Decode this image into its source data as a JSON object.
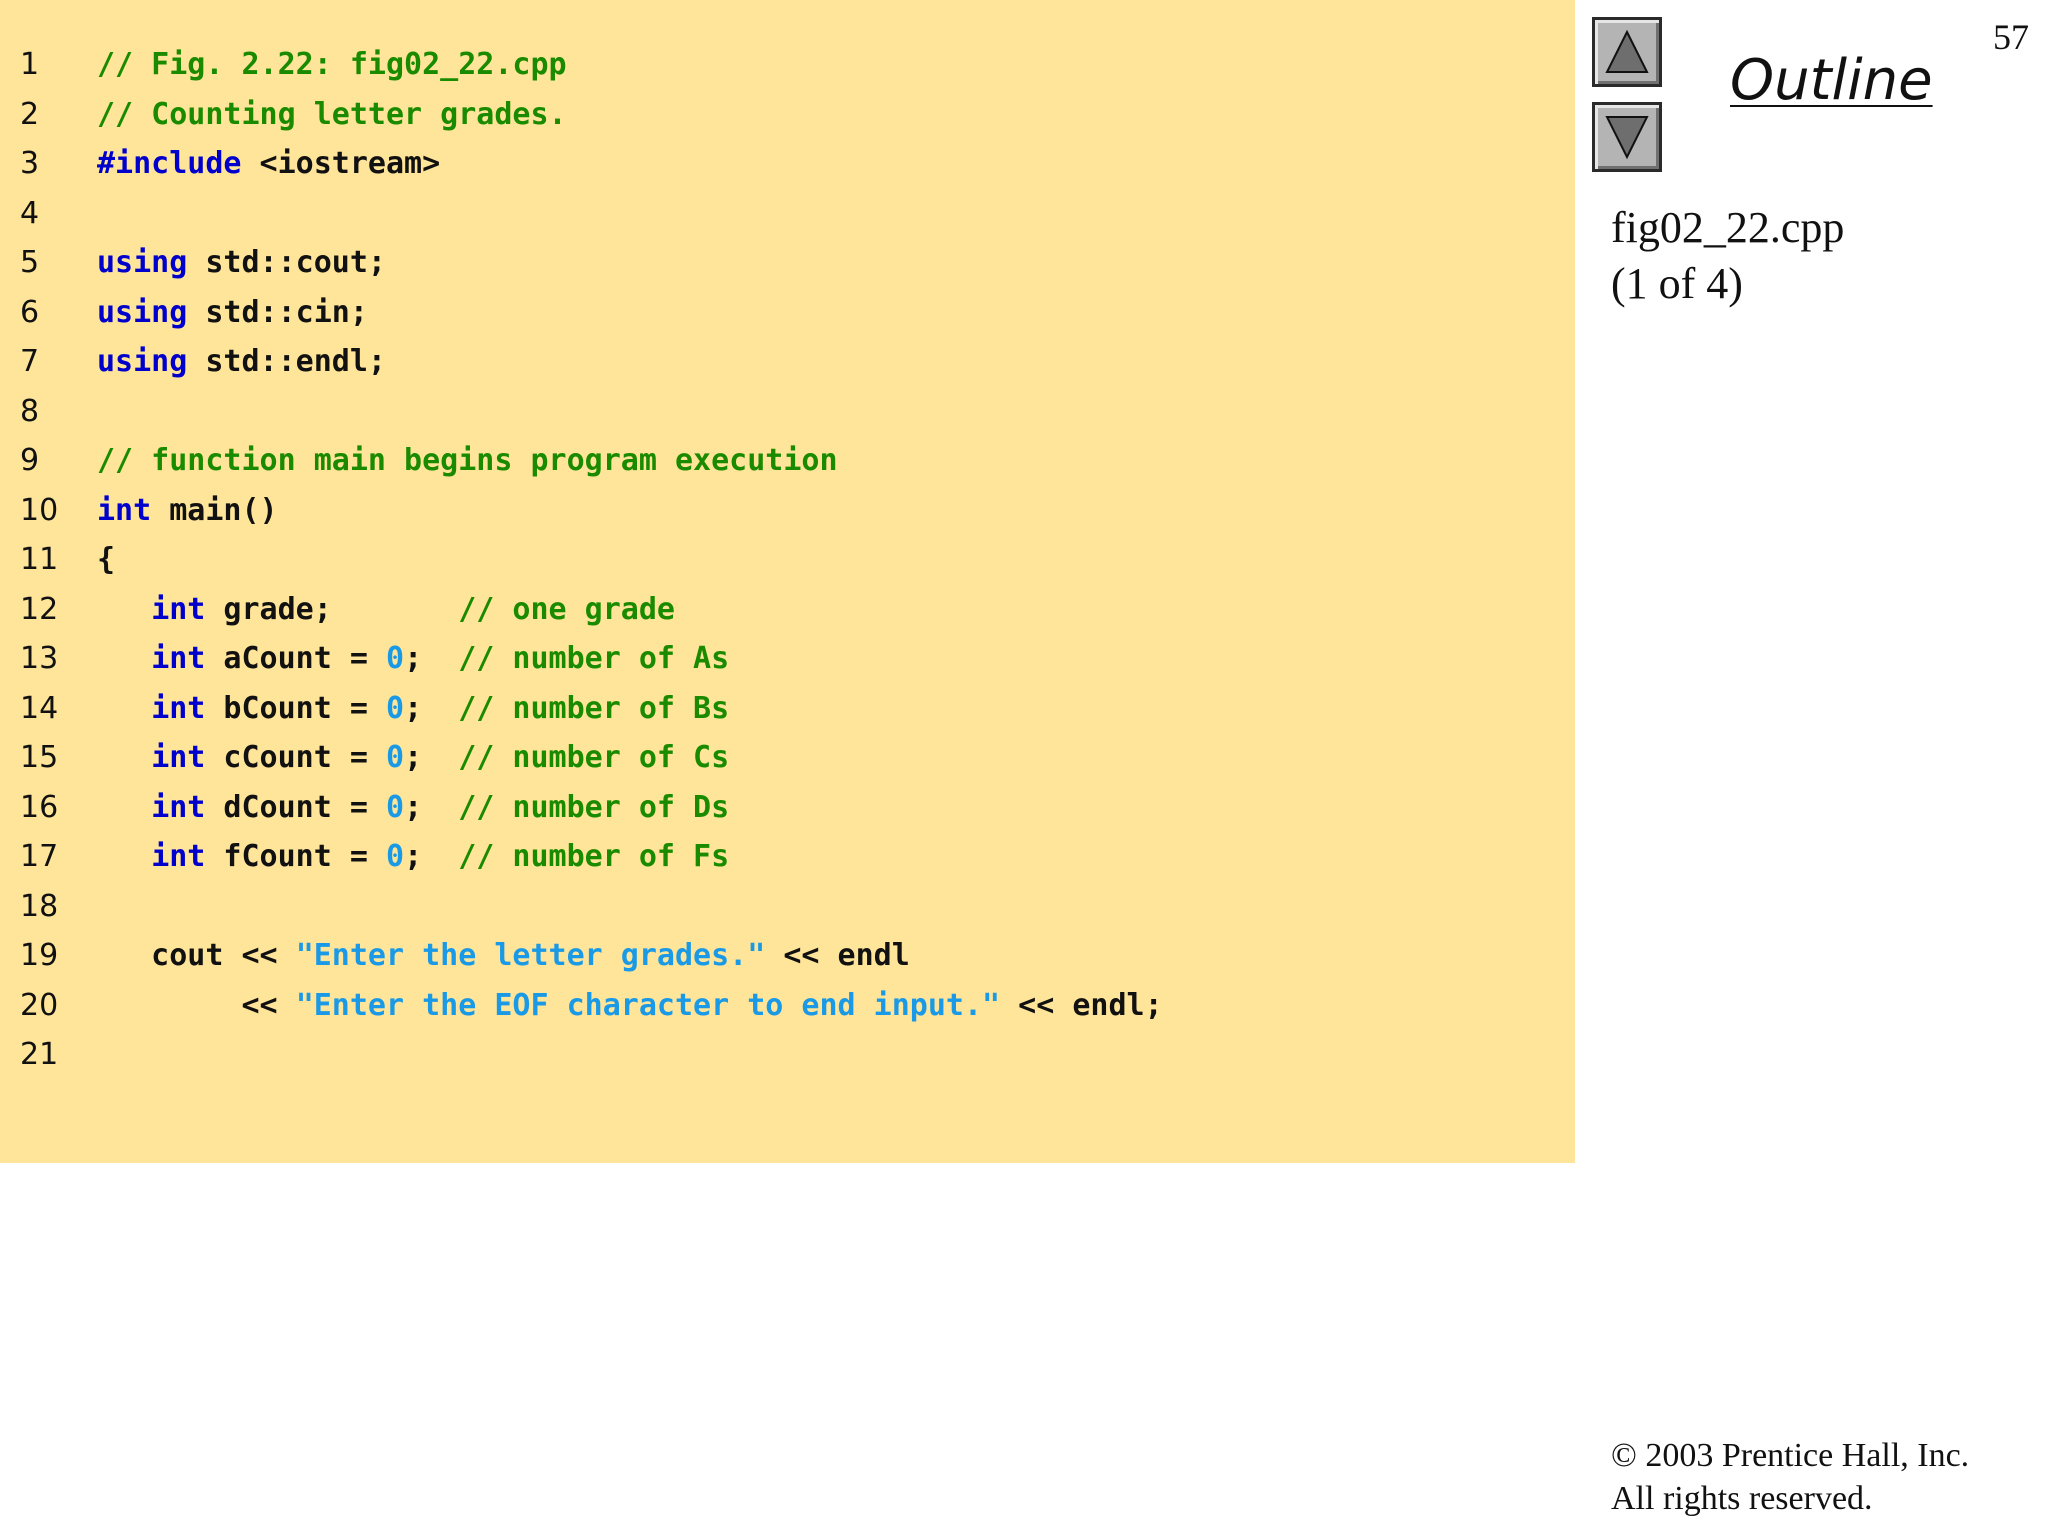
{
  "slide_number": "57",
  "outline": {
    "title": "Outline",
    "up_icon": "triangle-up-icon",
    "down_icon": "triangle-down-icon",
    "file_name": "fig02_22.cpp",
    "page_indicator": "(1 of 4)"
  },
  "code": {
    "colors": {
      "panel_background": "#ffe599",
      "comment": "#1a8a00",
      "keyword": "#0000cc",
      "plain": "#111111",
      "string": "#1a9ae6",
      "number": "#1a9ae6"
    },
    "lines": [
      {
        "number": "1",
        "tokens": [
          {
            "type": "comment",
            "text": "// Fig. 2.22: fig02_22.cpp"
          }
        ]
      },
      {
        "number": "2",
        "tokens": [
          {
            "type": "comment",
            "text": "// Counting letter grades."
          }
        ]
      },
      {
        "number": "3",
        "tokens": [
          {
            "type": "keyword",
            "text": "#include"
          },
          {
            "type": "plain",
            "text": " <iostream>"
          }
        ]
      },
      {
        "number": "4",
        "tokens": []
      },
      {
        "number": "5",
        "tokens": [
          {
            "type": "keyword",
            "text": "using"
          },
          {
            "type": "plain",
            "text": " std::cout;"
          }
        ]
      },
      {
        "number": "6",
        "tokens": [
          {
            "type": "keyword",
            "text": "using"
          },
          {
            "type": "plain",
            "text": " std::cin;"
          }
        ]
      },
      {
        "number": "7",
        "tokens": [
          {
            "type": "keyword",
            "text": "using"
          },
          {
            "type": "plain",
            "text": " std::endl;"
          }
        ]
      },
      {
        "number": "8",
        "tokens": []
      },
      {
        "number": "9",
        "tokens": [
          {
            "type": "comment",
            "text": "// function main begins program execution"
          }
        ]
      },
      {
        "number": "10",
        "tokens": [
          {
            "type": "keyword",
            "text": "int"
          },
          {
            "type": "plain",
            "text": " main()"
          }
        ]
      },
      {
        "number": "11",
        "tokens": [
          {
            "type": "plain",
            "text": "{"
          }
        ]
      },
      {
        "number": "12",
        "tokens": [
          {
            "type": "plain",
            "text": "   "
          },
          {
            "type": "keyword",
            "text": "int"
          },
          {
            "type": "plain",
            "text": " grade;       "
          },
          {
            "type": "comment",
            "text": "// one grade"
          }
        ]
      },
      {
        "number": "13",
        "tokens": [
          {
            "type": "plain",
            "text": "   "
          },
          {
            "type": "keyword",
            "text": "int"
          },
          {
            "type": "plain",
            "text": " aCount = "
          },
          {
            "type": "number",
            "text": "0"
          },
          {
            "type": "plain",
            "text": ";  "
          },
          {
            "type": "comment",
            "text": "// number of As"
          }
        ]
      },
      {
        "number": "14",
        "tokens": [
          {
            "type": "plain",
            "text": "   "
          },
          {
            "type": "keyword",
            "text": "int"
          },
          {
            "type": "plain",
            "text": " bCount = "
          },
          {
            "type": "number",
            "text": "0"
          },
          {
            "type": "plain",
            "text": ";  "
          },
          {
            "type": "comment",
            "text": "// number of Bs"
          }
        ]
      },
      {
        "number": "15",
        "tokens": [
          {
            "type": "plain",
            "text": "   "
          },
          {
            "type": "keyword",
            "text": "int"
          },
          {
            "type": "plain",
            "text": " cCount = "
          },
          {
            "type": "number",
            "text": "0"
          },
          {
            "type": "plain",
            "text": ";  "
          },
          {
            "type": "comment",
            "text": "// number of Cs"
          }
        ]
      },
      {
        "number": "16",
        "tokens": [
          {
            "type": "plain",
            "text": "   "
          },
          {
            "type": "keyword",
            "text": "int"
          },
          {
            "type": "plain",
            "text": " dCount = "
          },
          {
            "type": "number",
            "text": "0"
          },
          {
            "type": "plain",
            "text": ";  "
          },
          {
            "type": "comment",
            "text": "// number of Ds"
          }
        ]
      },
      {
        "number": "17",
        "tokens": [
          {
            "type": "plain",
            "text": "   "
          },
          {
            "type": "keyword",
            "text": "int"
          },
          {
            "type": "plain",
            "text": " fCount = "
          },
          {
            "type": "number",
            "text": "0"
          },
          {
            "type": "plain",
            "text": ";  "
          },
          {
            "type": "comment",
            "text": "// number of Fs"
          }
        ]
      },
      {
        "number": "18",
        "tokens": []
      },
      {
        "number": "19",
        "tokens": [
          {
            "type": "plain",
            "text": "   cout << "
          },
          {
            "type": "string",
            "text": "\"Enter the letter grades.\""
          },
          {
            "type": "plain",
            "text": " << endl"
          }
        ]
      },
      {
        "number": "20",
        "tokens": [
          {
            "type": "plain",
            "text": "        << "
          },
          {
            "type": "string",
            "text": "\"Enter the EOF character to end input.\""
          },
          {
            "type": "plain",
            "text": " << endl;"
          }
        ]
      },
      {
        "number": "21",
        "tokens": []
      }
    ]
  },
  "footer": {
    "copyright": "© 2003 Prentice Hall, Inc.",
    "rights": "All rights reserved."
  }
}
